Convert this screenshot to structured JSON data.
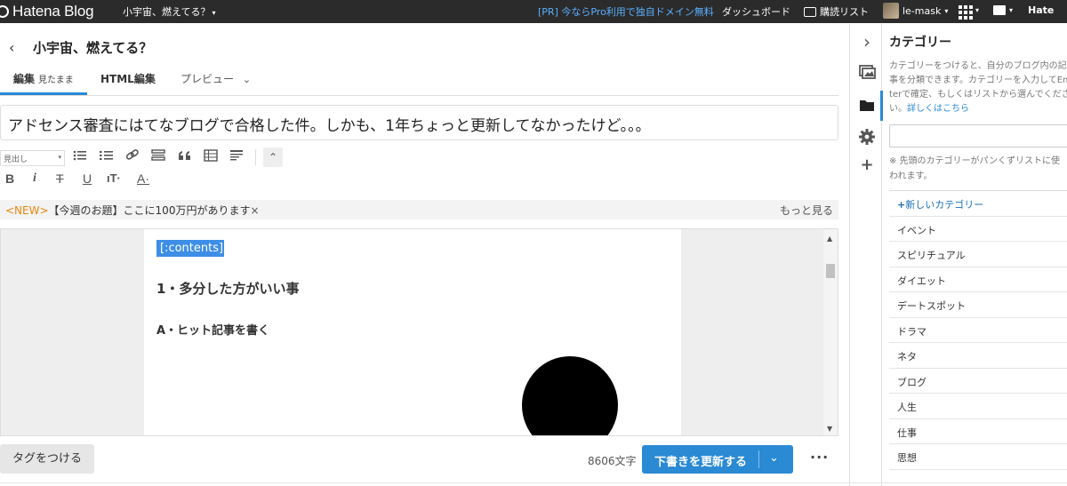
{
  "topbar": {
    "logo_text": "Hatena Blog",
    "blog_name": "小宇宙、燃えてる？",
    "pr_link": "[PR] 今ならPro利用で独自ドメイン無料",
    "dashboard": "ダッシュボード",
    "subscription": "購読リスト",
    "username": "le-mask",
    "hatena": "Hate",
    "caret": "▾"
  },
  "editor": {
    "back_icon": "‹",
    "title": "小宇宙、燃えてる？",
    "tabs": {
      "edit": "編集",
      "edit_sub": "見たまま",
      "html": "HTML編集",
      "preview": "プレビュー",
      "preview_chevron": "⌄"
    },
    "entry_title": "アドセンス審査にはてなブログで合格した件。しかも、1年ちょっと更新してなかったけど。。。",
    "toolbar": {
      "heading_select": "見出し",
      "caret": "▾",
      "collapse": "⌃",
      "bold": "B",
      "italic": "i",
      "strike": "T",
      "underline": "U",
      "size": "ıT·",
      "color": "A·"
    },
    "notice": {
      "new_tag": "<NEW>",
      "text": "【今週のお題】ここに100万円があります",
      "close": "×",
      "more": "もっと見る"
    },
    "body": {
      "selected": "[:contents]",
      "heading1": "1・多分した方がいい事",
      "heading2": "A・ヒット記事を書く"
    },
    "scroll": {
      "up": "▲",
      "down": "▼"
    }
  },
  "footer": {
    "tag_button": "タグをつける",
    "char_count": "8606文字",
    "save_button": "下書きを更新する",
    "save_chevron": "⌄",
    "more": "···"
  },
  "rail": {
    "collapse": "›",
    "add": "+"
  },
  "category_panel": {
    "title": "カテゴリー",
    "desc_lines": [
      "カテゴリーをつけると、自分のブログ内の記",
      "事を分類できます。カテゴリーを入力してEn",
      "terで確定、もしくはリストから選んでくださ"
    ],
    "desc_end": "い。",
    "desc_link": "詳しくはこちら",
    "note_lines": [
      "※ 先頭のカテゴリーがパンくずリストに使",
      "われます。"
    ],
    "new_category_plus": "+",
    "new_category": "新しいカテゴリー",
    "categories": [
      "イベント",
      "スピリチュアル",
      "ダイエット",
      "デートスポット",
      "ドラマ",
      "ネタ",
      "ブログ",
      "人生",
      "仕事",
      "思想"
    ]
  }
}
